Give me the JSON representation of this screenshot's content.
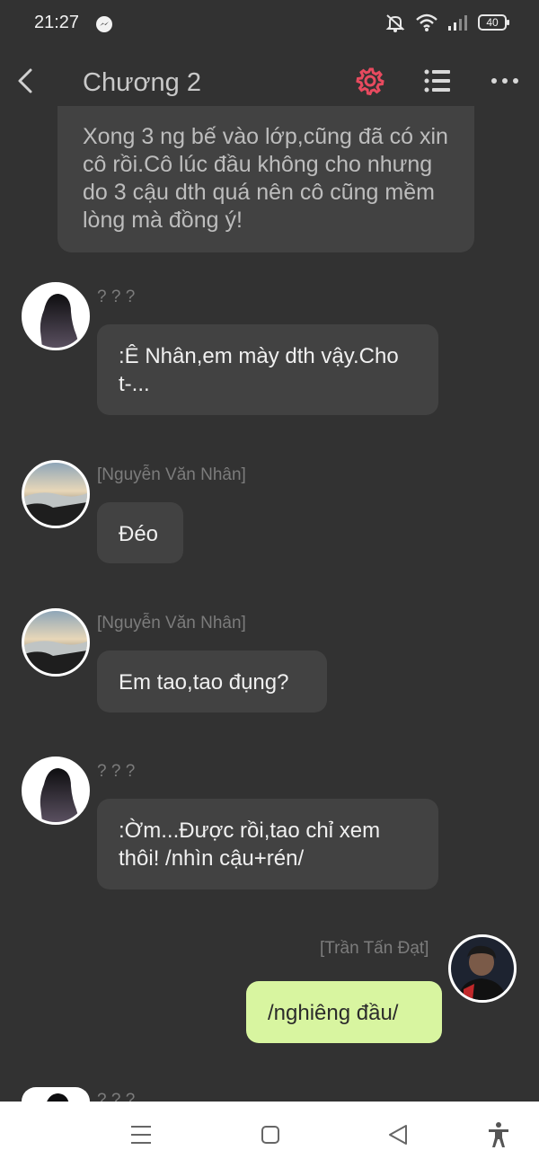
{
  "status": {
    "time": "21:27",
    "battery": "40",
    "icons": [
      "messenger-icon",
      "mute-icon",
      "wifi-icon",
      "signal-icon",
      "battery-icon"
    ]
  },
  "header": {
    "title": "Chương 2",
    "accent_color": "#e84a5f"
  },
  "narration": {
    "text": "Xong 3 ng bế vào lớp,cũng đã có xin cô rồi.Cô lúc đầu không cho nhưng do 3 cậu dth quá nên cô cũng mềm lòng mà đồng ý!"
  },
  "messages": [
    {
      "name": "? ? ?",
      "text": ":Ê Nhân,em mày dth vậy.Cho t-..."
    },
    {
      "name": "[Nguyễn Văn Nhân]",
      "text": "Đéo"
    },
    {
      "name": "[Nguyễn Văn Nhân]",
      "text": "Em tao,tao đụng?"
    },
    {
      "name": "? ? ?",
      "text": ":Ờm...Được rồi,tao chỉ xem thôi! /nhìn cậu+rén/"
    },
    {
      "name": "[Trần Tấn Đạt]",
      "text": "/nghiêng đầu/"
    },
    {
      "name": "? ? ?"
    }
  ],
  "colors": {
    "background": "#323232",
    "bubble": "#424242",
    "right_bubble": "#d8f5a0",
    "name_text": "#7c7c7c"
  }
}
